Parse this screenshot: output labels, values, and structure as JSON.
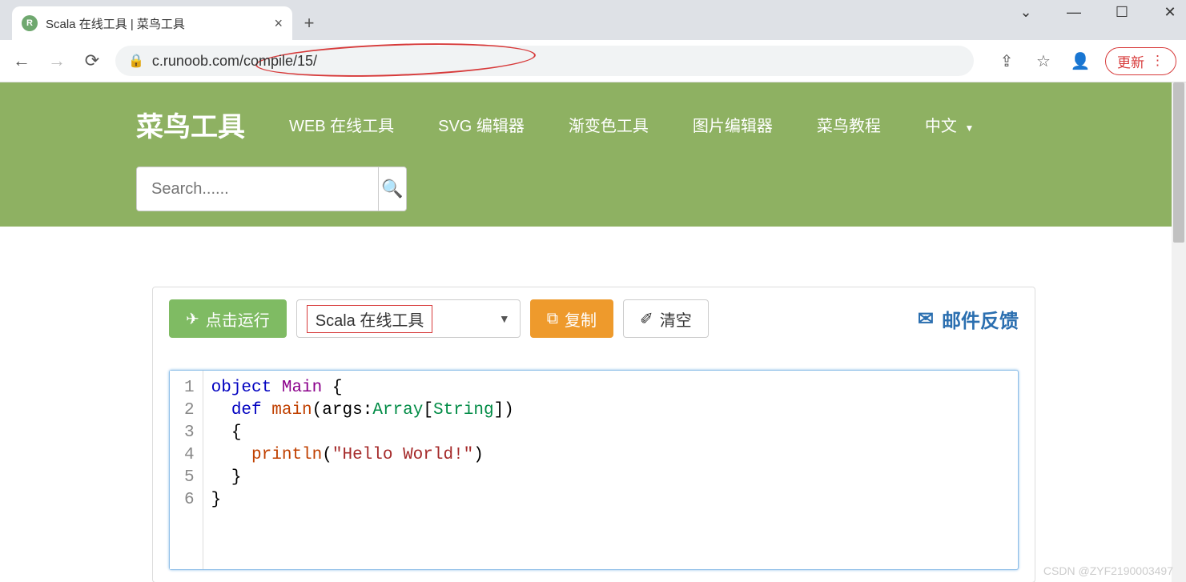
{
  "browser": {
    "tab_title": "Scala 在线工具 | 菜鸟工具",
    "url": "c.runoob.com/compile/15/",
    "update_label": "更新"
  },
  "header": {
    "logo": "菜鸟工具",
    "nav": [
      "WEB 在线工具",
      "SVG 编辑器",
      "渐变色工具",
      "图片编辑器",
      "菜鸟教程",
      "中文"
    ],
    "search_placeholder": "Search......"
  },
  "toolbar": {
    "run_label": "点击运行",
    "select_label": "Scala 在线工具",
    "copy_label": "复制",
    "clear_label": "清空",
    "feedback_label": "邮件反馈"
  },
  "code": {
    "line_numbers": [
      "1",
      "2",
      "3",
      "4",
      "5",
      "6"
    ],
    "l1": {
      "kw": "object",
      "cls": "Main",
      "brace": "{"
    },
    "l2": {
      "kw": "def",
      "fn": "main",
      "open": "(",
      "arg": "args",
      "colon": ":",
      "type1": "Array",
      "lb": "[",
      "type2": "String",
      "rb": "]",
      "close": ")"
    },
    "l3": {
      "brace": "{"
    },
    "l4": {
      "fn": "println",
      "open": "(",
      "str": "\"Hello World!\"",
      "close": ")"
    },
    "l5": {
      "brace": "}"
    },
    "l6": {
      "brace": "}"
    }
  },
  "watermark": "CSDN @ZYF2190003497"
}
